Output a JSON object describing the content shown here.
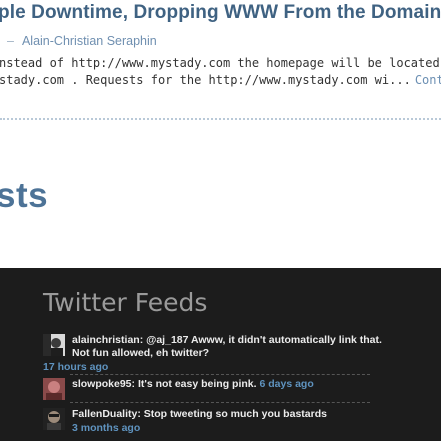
{
  "post": {
    "title": "ple Downtime, Dropping WWW From the Domain",
    "meta_dash": "–",
    "author": "Alain-Christian Seraphin",
    "excerpt_line1": "nstead of http://www.mystady.com the homepage will be located",
    "excerpt_line2": "stady.com . Requests for the http://www.mystady.com wi...",
    "continue_label": "Cont"
  },
  "section": {
    "heading": "sts"
  },
  "twitter": {
    "title": "Twitter Feeds",
    "tweets": [
      {
        "text": "alainchristian: @aj_187 Awww, it didn't automatically link that. Not fun allowed, eh twitter?",
        "time": "17 hours ago"
      },
      {
        "text": "slowpoke95: It's not easy being pink.",
        "time": "6 days ago"
      },
      {
        "text": "FallenDuality: Stop tweeting so much you bastards",
        "time": "3 months ago"
      }
    ]
  },
  "colors": {
    "post_title": "#3f6282",
    "link": "#6b8fb3",
    "panel_bg": "#1c1c1c",
    "tweet_time": "#5f93bf"
  }
}
